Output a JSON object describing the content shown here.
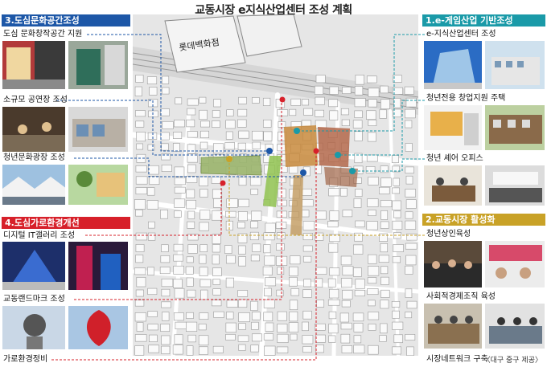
{
  "title": "교동시장 e지식산업센터 조성 계획",
  "map": {
    "label": "롯데백화점"
  },
  "sections": {
    "s1": {
      "header": "1.e-게임산업 기반조성",
      "color": "#1a9aa8",
      "items": [
        "e-지식산업센터 조성",
        "청년전용 창업지원 주택",
        "청년 셰어 오피스"
      ]
    },
    "s2": {
      "header": "2.교동시장 활성화",
      "color": "#c9a227",
      "items": [
        "청년상인육성",
        "사회적경제조직 육성",
        "시장네트워크 구축"
      ]
    },
    "s3": {
      "header": "3.도심문화공간조성",
      "color": "#1d57a7",
      "items": [
        "도심 문화창작공간 지원",
        "소규모 공연장 조성",
        "청년문화광장 조성"
      ]
    },
    "s4": {
      "header": "4.도심가로환경개선",
      "color": "#d7202a",
      "items": [
        "디지털 IT갤러리 조성",
        "교동랜드마크 조성",
        "가로환경정비"
      ]
    }
  },
  "credit": "〈대구 중구 제공〉"
}
